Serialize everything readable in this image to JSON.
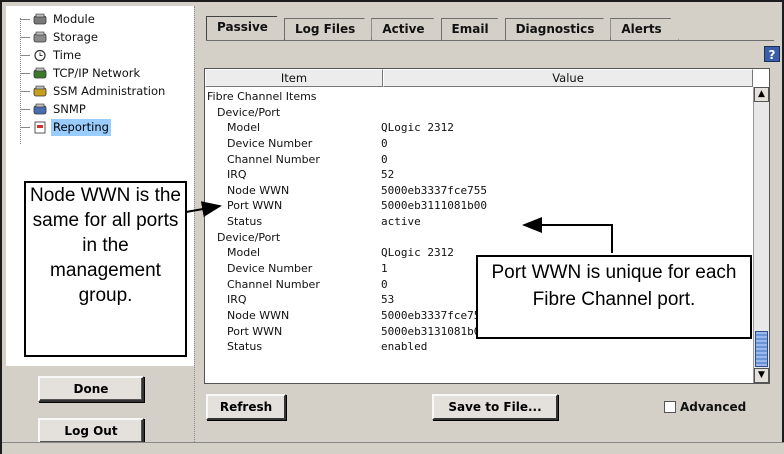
{
  "tree": {
    "items": [
      {
        "label": "Module",
        "icon": "module-icon"
      },
      {
        "label": "Storage",
        "icon": "storage-icon"
      },
      {
        "label": "Time",
        "icon": "clock-icon"
      },
      {
        "label": "TCP/IP Network",
        "icon": "network-icon"
      },
      {
        "label": "SSM Administration",
        "icon": "admin-icon"
      },
      {
        "label": "SNMP",
        "icon": "snmp-icon"
      },
      {
        "label": "Reporting",
        "icon": "reporting-icon",
        "selected": true
      }
    ]
  },
  "notes": {
    "left": "Node WWN is the same for all ports in the management group.",
    "right": "Port WWN is unique for each Fibre Channel port."
  },
  "left_buttons": {
    "done": "Done",
    "logout": "Log Out"
  },
  "tabs": [
    "Passive",
    "Log Files",
    "Active",
    "Email",
    "Diagnostics",
    "Alerts"
  ],
  "active_tab": "Passive",
  "help_icon": "?",
  "table": {
    "headers": {
      "item": "Item",
      "value": "Value"
    },
    "rows": [
      {
        "item": "Fibre Channel Items",
        "value": "",
        "level": 0
      },
      {
        "item": "Device/Port",
        "value": "",
        "level": 1
      },
      {
        "item": "Model",
        "value": "QLogic 2312",
        "level": 2
      },
      {
        "item": "Device Number",
        "value": "0",
        "level": 2
      },
      {
        "item": "Channel Number",
        "value": "0",
        "level": 2
      },
      {
        "item": "IRQ",
        "value": "52",
        "level": 2
      },
      {
        "item": "Node WWN",
        "value": "5000eb3337fce755",
        "level": 2
      },
      {
        "item": "Port WWN",
        "value": "5000eb3111081b00",
        "level": 2
      },
      {
        "item": "Status",
        "value": "active",
        "level": 2
      },
      {
        "item": "Device/Port",
        "value": "",
        "level": 1
      },
      {
        "item": "Model",
        "value": "QLogic 2312",
        "level": 2
      },
      {
        "item": "Device Number",
        "value": "1",
        "level": 2
      },
      {
        "item": "Channel Number",
        "value": "0",
        "level": 2
      },
      {
        "item": "IRQ",
        "value": "53",
        "level": 2
      },
      {
        "item": "Node WWN",
        "value": "5000eb3337fce755",
        "level": 2
      },
      {
        "item": "Port WWN",
        "value": "5000eb3131081b01",
        "level": 2
      },
      {
        "item": "Status",
        "value": "enabled",
        "level": 2
      }
    ]
  },
  "buttons": {
    "refresh": "Refresh",
    "save": "Save to File...",
    "advanced": "Advanced"
  },
  "colors": {
    "selection": "#99ccff",
    "scroll_thumb": "#6b94d6",
    "help_icon": "#3a5fa8"
  }
}
